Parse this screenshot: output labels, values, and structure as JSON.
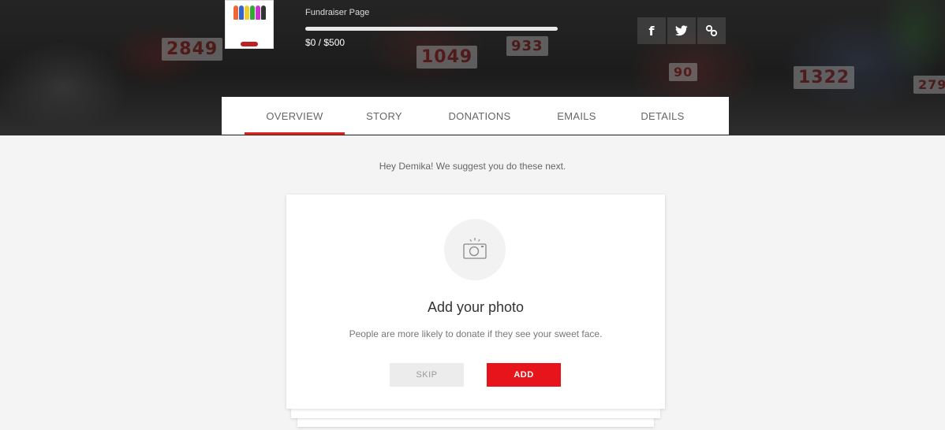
{
  "hero": {
    "page_label": "Fundraiser Page",
    "progress_text": "$0 / $500",
    "progress_fraction": 0.0,
    "bibs": [
      "2849",
      "1049",
      "933",
      "90",
      "1322",
      "279"
    ],
    "share": [
      {
        "icon": "facebook-icon",
        "glyph": "f"
      },
      {
        "icon": "twitter-icon",
        "glyph": "bird"
      },
      {
        "icon": "link-icon",
        "glyph": "link"
      }
    ]
  },
  "tabs": [
    {
      "label": "OVERVIEW",
      "active": true
    },
    {
      "label": "STORY",
      "active": false
    },
    {
      "label": "DONATIONS",
      "active": false
    },
    {
      "label": "EMAILS",
      "active": false
    },
    {
      "label": "DETAILS",
      "active": false
    }
  ],
  "main": {
    "suggest_text": "Hey Demika! We suggest you do these next.",
    "card": {
      "icon": "camera-icon",
      "title": "Add your photo",
      "subtitle": "People are more likely to donate if they see your sweet face.",
      "skip_label": "SKIP",
      "add_label": "ADD"
    }
  },
  "colors": {
    "accent": "#e0201c",
    "background": "#f4f4f4"
  }
}
